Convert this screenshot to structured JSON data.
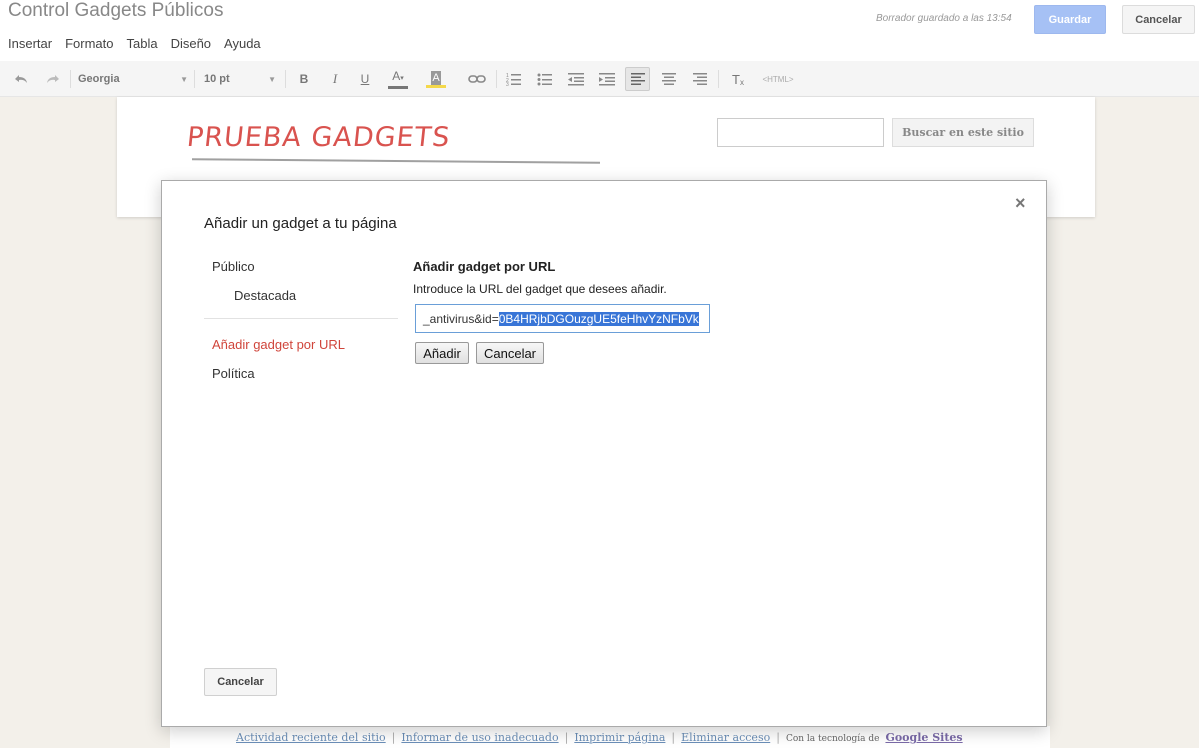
{
  "header": {
    "title": "Control Gadgets Públicos",
    "draft_status": "Borrador guardado a las 13:54",
    "save_label": "Guardar",
    "cancel_label": "Cancelar"
  },
  "menu": {
    "items": [
      "Insertar",
      "Formato",
      "Tabla",
      "Diseño",
      "Ayuda"
    ]
  },
  "toolbar": {
    "font": "Georgia",
    "size": "10 pt",
    "html_label": "<HTML>",
    "icons": [
      "undo-icon",
      "redo-icon",
      "bold-icon",
      "italic-icon",
      "underline-icon",
      "text-color-icon",
      "highlight-icon",
      "link-icon",
      "numbered-list-icon",
      "bulleted-list-icon",
      "outdent-icon",
      "indent-icon",
      "align-left-icon",
      "align-center-icon",
      "align-right-icon",
      "clear-format-icon"
    ]
  },
  "site": {
    "title": "PRUEBA GADGETS",
    "search_button": "Buscar en este sitio",
    "search_value": ""
  },
  "modal": {
    "title": "Añadir un gadget a tu página",
    "categories": {
      "publico": "Público",
      "destacada": "Destacada",
      "url": "Añadir gadget por URL",
      "politica": "Política"
    },
    "selected_category": "Añadir gadget por URL",
    "panel_heading": "Añadir gadget por URL",
    "panel_instruction": "Introduce la URL del gadget que desees añadir.",
    "url_value_prefix": "_antivirus&id=",
    "url_value_selected": "0B4HRjbDGOuzgUE5feHhvYzNFbVk",
    "add_label": "Añadir",
    "cancel_inner_label": "Cancelar",
    "cancel_label": "Cancelar",
    "close_symbol": "×"
  },
  "footer": {
    "links": [
      "Actividad reciente del sitio",
      "Informar de uso inadecuado",
      "Imprimir página",
      "Eliminar acceso"
    ],
    "powered_by": "Con la tecnología de",
    "brand": "Google Sites"
  },
  "colors": {
    "accent": "#a6c1f5",
    "selected_category": "#d0453b",
    "site_title": "#d9534f",
    "selection": "#3875d7"
  }
}
